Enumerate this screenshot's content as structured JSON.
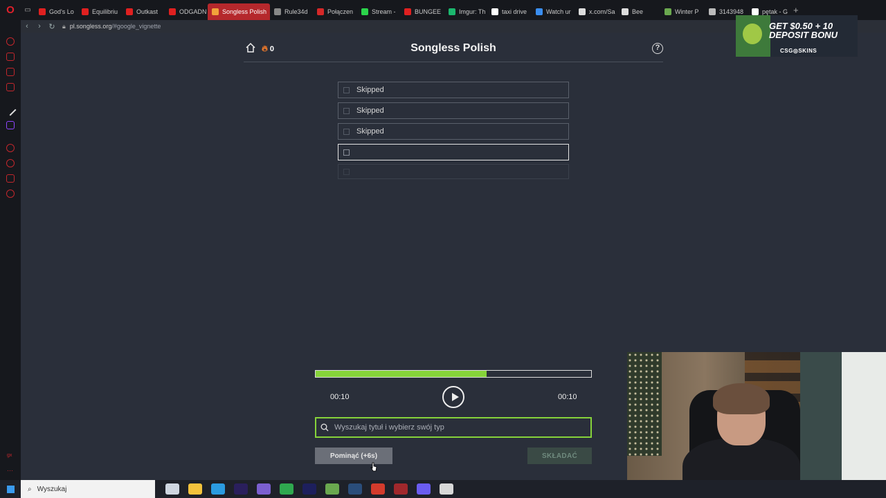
{
  "browser": {
    "tabs": [
      {
        "label": "God's Lo",
        "color": "#e02020"
      },
      {
        "label": "Equilibriu",
        "color": "#e02020"
      },
      {
        "label": "Outkast",
        "color": "#e02020"
      },
      {
        "label": "ODGADN",
        "color": "#e02020"
      },
      {
        "label": "Songless Polish",
        "color": "#f2a23a",
        "active": true
      },
      {
        "label": "Rule34d",
        "color": "#888888"
      },
      {
        "label": "Połączen",
        "color": "#d62828"
      },
      {
        "label": "Stream -",
        "color": "#2bd44b"
      },
      {
        "label": "BUNGEE",
        "color": "#e02020"
      },
      {
        "label": "Imgur: Th",
        "color": "#1bb76e"
      },
      {
        "label": "taxi drive",
        "color": "#ffffff"
      },
      {
        "label": "Watch ur",
        "color": "#3a8ef0"
      },
      {
        "label": "x.com/Sa",
        "color": "#dddddd"
      },
      {
        "label": "Bee",
        "color": "#dddddd"
      },
      {
        "label": "Winter P",
        "color": "#6aa84f"
      },
      {
        "label": "3143948",
        "color": "#bbbbbb"
      },
      {
        "label": "pętak - G",
        "color": "#ffffff"
      }
    ],
    "url_host": "pl.songless.org",
    "url_path": "/#google_vignette"
  },
  "game": {
    "title": "Songless Polish",
    "streak": "0",
    "guesses": [
      {
        "text": "Skipped",
        "state": "skipped"
      },
      {
        "text": "Skipped",
        "state": "skipped"
      },
      {
        "text": "Skipped",
        "state": "skipped"
      },
      {
        "text": "",
        "state": "current"
      },
      {
        "text": "",
        "state": "locked"
      }
    ],
    "progress": 0.62,
    "time_elapsed": "00:10",
    "time_total": "00:10",
    "search_placeholder": "Wyszukaj tytuł i wybierz swój typ",
    "skip_label": "Pominąć (+6s)",
    "submit_label": "SKŁADAĆ",
    "accent_color": "#86d33a"
  },
  "ad": {
    "line1": "GET $0.50 + 10",
    "line2": "DEPOSIT BONU",
    "brand": "CSG◎SKINS"
  },
  "taskbar": {
    "search_label": "Wyszukaj",
    "apps": [
      "task-view",
      "file-explorer",
      "vscode",
      "premiere",
      "obs",
      "chrome",
      "after-effects",
      "minecraft",
      "steam",
      "chrome-alt",
      "opera",
      "discord",
      "paint"
    ]
  }
}
